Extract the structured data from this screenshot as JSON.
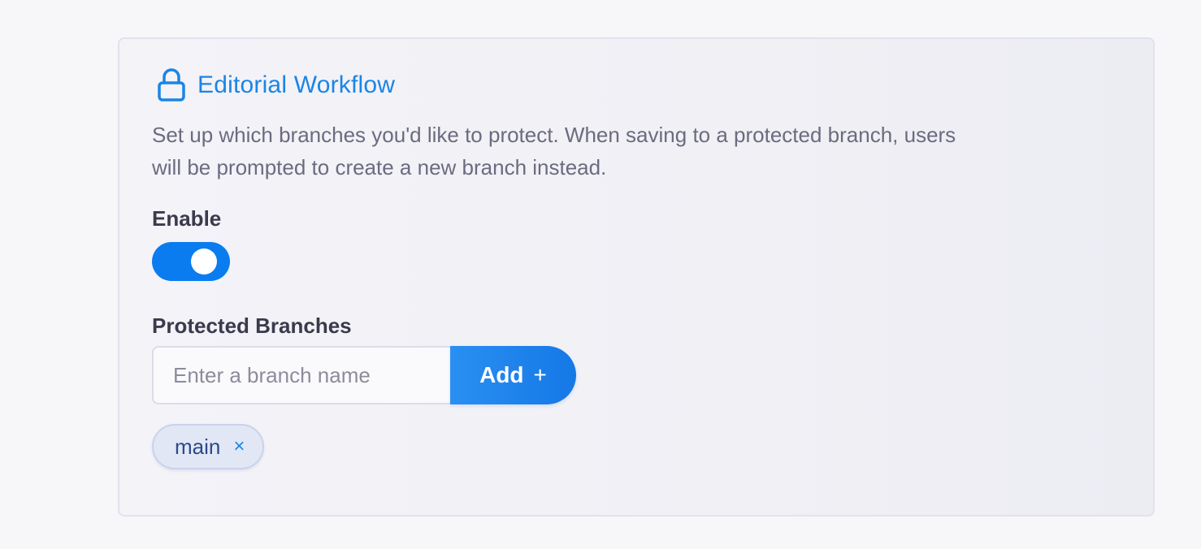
{
  "section": {
    "title": "Editorial Workflow",
    "icon": "lock-icon",
    "accent_color": "#1a85e6",
    "description": "Set up which branches you'd like to protect. When saving to a protected branch, users will be prompted to create a new branch instead."
  },
  "enable": {
    "label": "Enable",
    "value": true,
    "toggle_color": "#0a7cf0"
  },
  "protected_branches": {
    "label": "Protected Branches",
    "input": {
      "value": "",
      "placeholder": "Enter a branch name"
    },
    "add_label": "Add",
    "add_icon": "+",
    "tags": [
      {
        "label": "main",
        "remove_icon": "×"
      }
    ]
  }
}
